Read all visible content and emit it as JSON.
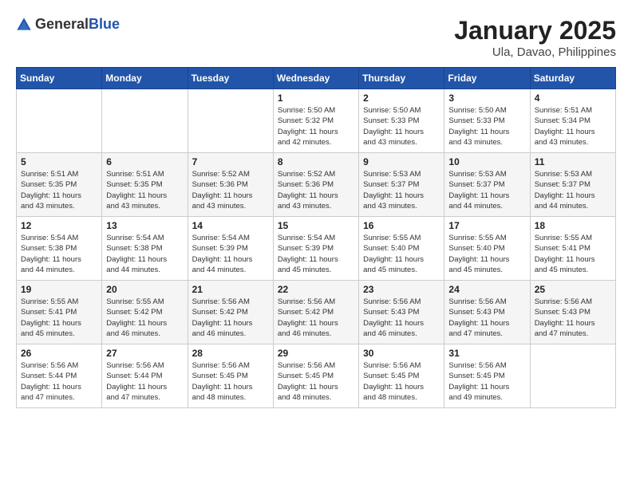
{
  "header": {
    "logo_general": "General",
    "logo_blue": "Blue",
    "month": "January 2025",
    "location": "Ula, Davao, Philippines"
  },
  "days_of_week": [
    "Sunday",
    "Monday",
    "Tuesday",
    "Wednesday",
    "Thursday",
    "Friday",
    "Saturday"
  ],
  "weeks": [
    [
      {
        "day": "",
        "content": ""
      },
      {
        "day": "",
        "content": ""
      },
      {
        "day": "",
        "content": ""
      },
      {
        "day": "1",
        "content": "Sunrise: 5:50 AM\nSunset: 5:32 PM\nDaylight: 11 hours\nand 42 minutes."
      },
      {
        "day": "2",
        "content": "Sunrise: 5:50 AM\nSunset: 5:33 PM\nDaylight: 11 hours\nand 43 minutes."
      },
      {
        "day": "3",
        "content": "Sunrise: 5:50 AM\nSunset: 5:33 PM\nDaylight: 11 hours\nand 43 minutes."
      },
      {
        "day": "4",
        "content": "Sunrise: 5:51 AM\nSunset: 5:34 PM\nDaylight: 11 hours\nand 43 minutes."
      }
    ],
    [
      {
        "day": "5",
        "content": "Sunrise: 5:51 AM\nSunset: 5:35 PM\nDaylight: 11 hours\nand 43 minutes."
      },
      {
        "day": "6",
        "content": "Sunrise: 5:51 AM\nSunset: 5:35 PM\nDaylight: 11 hours\nand 43 minutes."
      },
      {
        "day": "7",
        "content": "Sunrise: 5:52 AM\nSunset: 5:36 PM\nDaylight: 11 hours\nand 43 minutes."
      },
      {
        "day": "8",
        "content": "Sunrise: 5:52 AM\nSunset: 5:36 PM\nDaylight: 11 hours\nand 43 minutes."
      },
      {
        "day": "9",
        "content": "Sunrise: 5:53 AM\nSunset: 5:37 PM\nDaylight: 11 hours\nand 43 minutes."
      },
      {
        "day": "10",
        "content": "Sunrise: 5:53 AM\nSunset: 5:37 PM\nDaylight: 11 hours\nand 44 minutes."
      },
      {
        "day": "11",
        "content": "Sunrise: 5:53 AM\nSunset: 5:37 PM\nDaylight: 11 hours\nand 44 minutes."
      }
    ],
    [
      {
        "day": "12",
        "content": "Sunrise: 5:54 AM\nSunset: 5:38 PM\nDaylight: 11 hours\nand 44 minutes."
      },
      {
        "day": "13",
        "content": "Sunrise: 5:54 AM\nSunset: 5:38 PM\nDaylight: 11 hours\nand 44 minutes."
      },
      {
        "day": "14",
        "content": "Sunrise: 5:54 AM\nSunset: 5:39 PM\nDaylight: 11 hours\nand 44 minutes."
      },
      {
        "day": "15",
        "content": "Sunrise: 5:54 AM\nSunset: 5:39 PM\nDaylight: 11 hours\nand 45 minutes."
      },
      {
        "day": "16",
        "content": "Sunrise: 5:55 AM\nSunset: 5:40 PM\nDaylight: 11 hours\nand 45 minutes."
      },
      {
        "day": "17",
        "content": "Sunrise: 5:55 AM\nSunset: 5:40 PM\nDaylight: 11 hours\nand 45 minutes."
      },
      {
        "day": "18",
        "content": "Sunrise: 5:55 AM\nSunset: 5:41 PM\nDaylight: 11 hours\nand 45 minutes."
      }
    ],
    [
      {
        "day": "19",
        "content": "Sunrise: 5:55 AM\nSunset: 5:41 PM\nDaylight: 11 hours\nand 45 minutes."
      },
      {
        "day": "20",
        "content": "Sunrise: 5:55 AM\nSunset: 5:42 PM\nDaylight: 11 hours\nand 46 minutes."
      },
      {
        "day": "21",
        "content": "Sunrise: 5:56 AM\nSunset: 5:42 PM\nDaylight: 11 hours\nand 46 minutes."
      },
      {
        "day": "22",
        "content": "Sunrise: 5:56 AM\nSunset: 5:42 PM\nDaylight: 11 hours\nand 46 minutes."
      },
      {
        "day": "23",
        "content": "Sunrise: 5:56 AM\nSunset: 5:43 PM\nDaylight: 11 hours\nand 46 minutes."
      },
      {
        "day": "24",
        "content": "Sunrise: 5:56 AM\nSunset: 5:43 PM\nDaylight: 11 hours\nand 47 minutes."
      },
      {
        "day": "25",
        "content": "Sunrise: 5:56 AM\nSunset: 5:43 PM\nDaylight: 11 hours\nand 47 minutes."
      }
    ],
    [
      {
        "day": "26",
        "content": "Sunrise: 5:56 AM\nSunset: 5:44 PM\nDaylight: 11 hours\nand 47 minutes."
      },
      {
        "day": "27",
        "content": "Sunrise: 5:56 AM\nSunset: 5:44 PM\nDaylight: 11 hours\nand 47 minutes."
      },
      {
        "day": "28",
        "content": "Sunrise: 5:56 AM\nSunset: 5:45 PM\nDaylight: 11 hours\nand 48 minutes."
      },
      {
        "day": "29",
        "content": "Sunrise: 5:56 AM\nSunset: 5:45 PM\nDaylight: 11 hours\nand 48 minutes."
      },
      {
        "day": "30",
        "content": "Sunrise: 5:56 AM\nSunset: 5:45 PM\nDaylight: 11 hours\nand 48 minutes."
      },
      {
        "day": "31",
        "content": "Sunrise: 5:56 AM\nSunset: 5:45 PM\nDaylight: 11 hours\nand 49 minutes."
      },
      {
        "day": "",
        "content": ""
      }
    ]
  ]
}
